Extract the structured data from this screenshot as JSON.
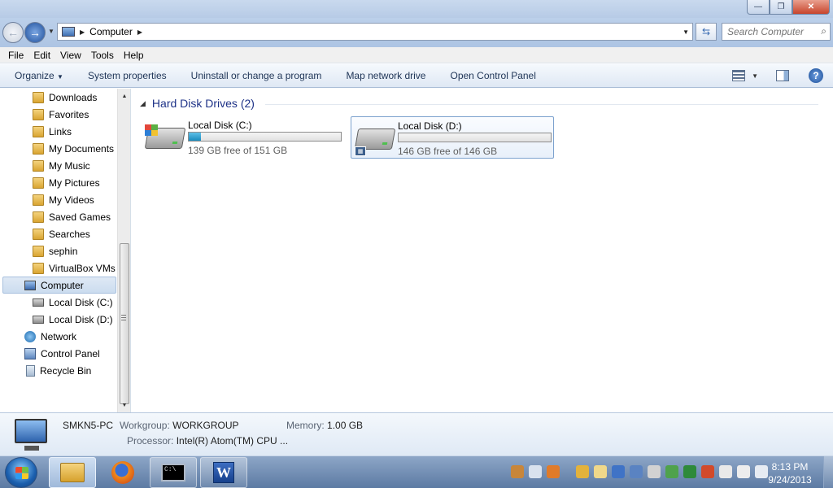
{
  "window": {
    "minimize_glyph": "—",
    "maximize_glyph": "❐",
    "close_glyph": "✕"
  },
  "address": {
    "crumb": "Computer",
    "search_placeholder": "Search Computer"
  },
  "menu": [
    "File",
    "Edit",
    "View",
    "Tools",
    "Help"
  ],
  "commands": {
    "organize": "Organize",
    "system_properties": "System properties",
    "uninstall": "Uninstall or change a program",
    "map_drive": "Map network drive",
    "control_panel": "Open Control Panel"
  },
  "nav": {
    "downloads": "Downloads",
    "favorites": "Favorites",
    "links": "Links",
    "my_documents": "My Documents",
    "my_music": "My Music",
    "my_pictures": "My Pictures",
    "my_videos": "My Videos",
    "saved_games": "Saved Games",
    "searches": "Searches",
    "sephin": "sephin",
    "virtualbox": "VirtualBox VMs",
    "computer": "Computer",
    "local_c": "Local Disk (C:)",
    "local_d": "Local Disk (D:)",
    "network": "Network",
    "control_panel": "Control Panel",
    "recycle_bin": "Recycle Bin"
  },
  "group": {
    "title": "Hard Disk Drives (2)"
  },
  "drives": [
    {
      "name": "Local Disk (C:)",
      "free_text": "139 GB free of 151 GB",
      "used_fraction": 0.08
    },
    {
      "name": "Local Disk (D:)",
      "free_text": "146 GB free of 146 GB",
      "used_fraction": 0.0
    }
  ],
  "details": {
    "pc_name": "SMKN5-PC",
    "workgroup_label": "Workgroup:",
    "workgroup_value": "WORKGROUP",
    "memory_label": "Memory:",
    "memory_value": "1.00 GB",
    "processor_label": "Processor:",
    "processor_value": "Intel(R) Atom(TM) CPU ..."
  },
  "taskbar": {
    "cmd_text": "C:\\",
    "word_letter": "W",
    "time": "8:13 PM",
    "date": "9/24/2013"
  },
  "colors": {
    "accent": "#1e3287",
    "bar_fill": "#1a8bbd"
  }
}
